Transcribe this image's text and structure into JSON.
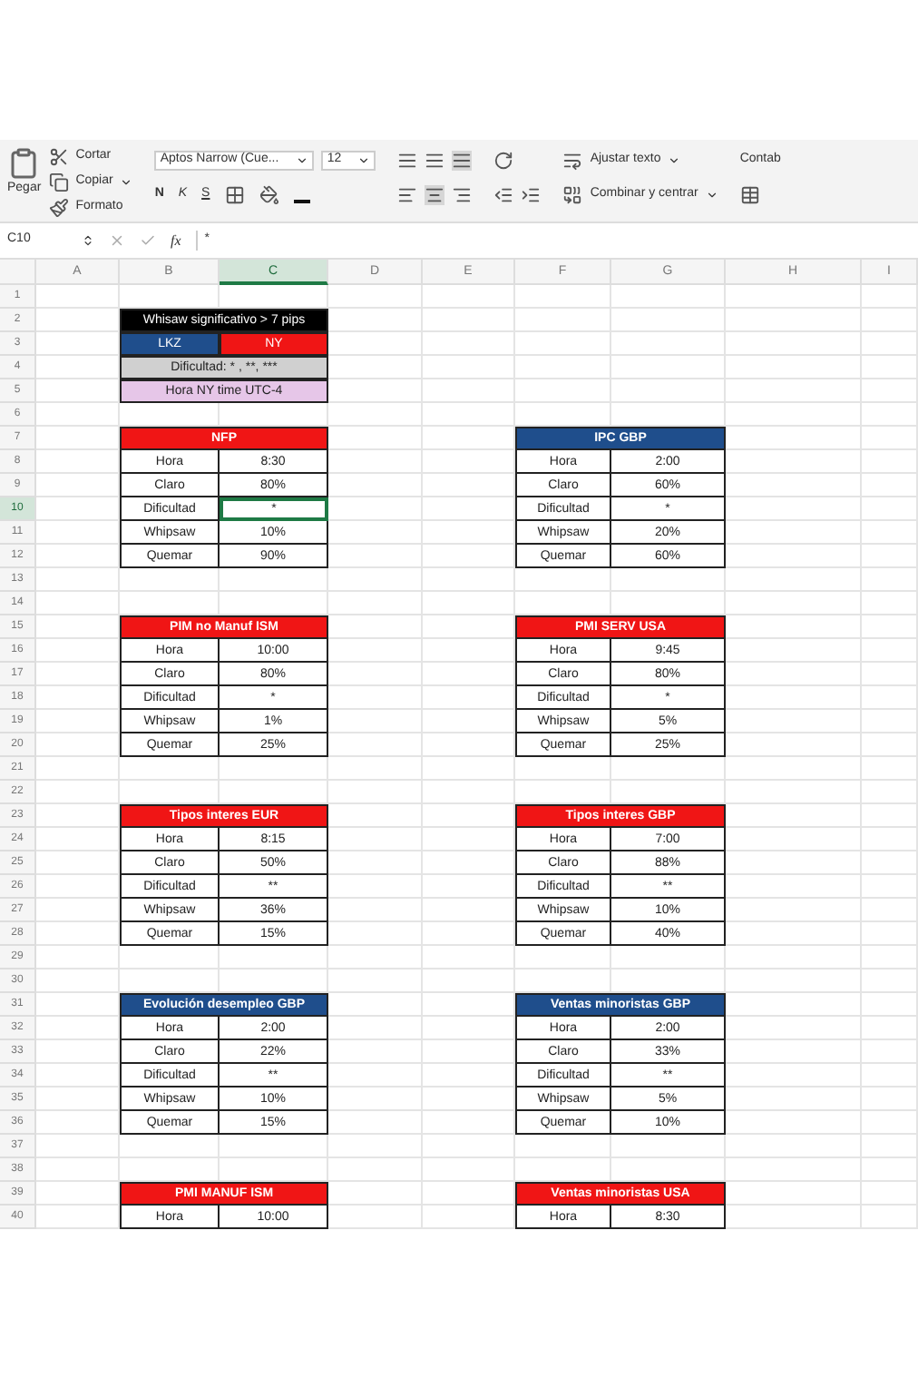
{
  "ribbon": {
    "clipboard": {
      "paste": "Pegar",
      "cut": "Cortar",
      "copy": "Copiar",
      "format": "Formato"
    },
    "font": {
      "name": "Aptos Narrow (Cue...",
      "size": "12",
      "styles": [
        "N",
        "K",
        "S"
      ]
    },
    "wrap_text": "Ajustar texto",
    "merge": "Combinar y centrar",
    "number_format": "Contab"
  },
  "formula_bar": {
    "name_box": "C10",
    "fx": "fx",
    "value": "*"
  },
  "columns": [
    {
      "label": "A",
      "selected": false
    },
    {
      "label": "B",
      "selected": false
    },
    {
      "label": "C",
      "selected": true
    },
    {
      "label": "D",
      "selected": false
    },
    {
      "label": "E",
      "selected": false
    },
    {
      "label": "F",
      "selected": false
    },
    {
      "label": "G",
      "selected": false
    },
    {
      "label": "H",
      "selected": false
    },
    {
      "label": "I",
      "selected": false
    }
  ],
  "row_numbers": [
    {
      "label": "1",
      "selected": false
    },
    {
      "label": "2",
      "selected": false
    },
    {
      "label": "3",
      "selected": false
    },
    {
      "label": "4",
      "selected": false
    },
    {
      "label": "5",
      "selected": false
    },
    {
      "label": "6",
      "selected": false
    },
    {
      "label": "7",
      "selected": false
    },
    {
      "label": "8",
      "selected": false
    },
    {
      "label": "9",
      "selected": false
    },
    {
      "label": "10",
      "selected": true
    },
    {
      "label": "11",
      "selected": false
    },
    {
      "label": "12",
      "selected": false
    },
    {
      "label": "13",
      "selected": false
    },
    {
      "label": "14",
      "selected": false
    },
    {
      "label": "15",
      "selected": false
    },
    {
      "label": "16",
      "selected": false
    },
    {
      "label": "17",
      "selected": false
    },
    {
      "label": "18",
      "selected": false
    },
    {
      "label": "19",
      "selected": false
    },
    {
      "label": "20",
      "selected": false
    },
    {
      "label": "21",
      "selected": false
    },
    {
      "label": "22",
      "selected": false
    },
    {
      "label": "23",
      "selected": false
    },
    {
      "label": "24",
      "selected": false
    },
    {
      "label": "25",
      "selected": false
    },
    {
      "label": "26",
      "selected": false
    },
    {
      "label": "27",
      "selected": false
    },
    {
      "label": "28",
      "selected": false
    },
    {
      "label": "29",
      "selected": false
    },
    {
      "label": "30",
      "selected": false
    },
    {
      "label": "31",
      "selected": false
    },
    {
      "label": "32",
      "selected": false
    },
    {
      "label": "33",
      "selected": false
    },
    {
      "label": "34",
      "selected": false
    },
    {
      "label": "35",
      "selected": false
    },
    {
      "label": "36",
      "selected": false
    },
    {
      "label": "37",
      "selected": false
    },
    {
      "label": "38",
      "selected": false
    },
    {
      "label": "39",
      "selected": false
    },
    {
      "label": "40",
      "selected": false
    }
  ],
  "legend": [
    {
      "kind": "title",
      "text": "Whisaw significativo > 7 pips"
    },
    {
      "kind": "split",
      "items": [
        {
          "text": "LKZ",
          "color": "#1f4e8c"
        },
        {
          "text": "NY",
          "color": "#f01515"
        }
      ]
    },
    {
      "kind": "note",
      "text": "Dificultad: * , **, ***",
      "color": "#d0d0d0"
    },
    {
      "kind": "note",
      "text": "Hora NY time UTC-4",
      "color": "#e6c6e8"
    }
  ],
  "tables": [
    {
      "title": "NFP",
      "color": "#f01515",
      "rows": [
        {
          "label": "Hora",
          "value": "8:30",
          "selected": false
        },
        {
          "label": "Claro",
          "value": "80%",
          "selected": false
        },
        {
          "label": "Dificultad",
          "value": "*",
          "selected": true
        },
        {
          "label": "Whipsaw",
          "value": "10%",
          "selected": false
        },
        {
          "label": "Quemar",
          "value": "90%",
          "selected": false
        }
      ]
    },
    {
      "title": "IPC GBP",
      "color": "#1f4e8c",
      "rows": [
        {
          "label": "Hora",
          "value": "2:00",
          "selected": false
        },
        {
          "label": "Claro",
          "value": "60%",
          "selected": false
        },
        {
          "label": "Dificultad",
          "value": "*",
          "selected": false
        },
        {
          "label": "Whipsaw",
          "value": "20%",
          "selected": false
        },
        {
          "label": "Quemar",
          "value": "60%",
          "selected": false
        }
      ]
    },
    {
      "title": "PIM no Manuf ISM",
      "color": "#f01515",
      "rows": [
        {
          "label": "Hora",
          "value": "10:00",
          "selected": false
        },
        {
          "label": "Claro",
          "value": "80%",
          "selected": false
        },
        {
          "label": "Dificultad",
          "value": "*",
          "selected": false
        },
        {
          "label": "Whipsaw",
          "value": "1%",
          "selected": false
        },
        {
          "label": "Quemar",
          "value": "25%",
          "selected": false
        }
      ]
    },
    {
      "title": "PMI SERV USA",
      "color": "#f01515",
      "rows": [
        {
          "label": "Hora",
          "value": "9:45",
          "selected": false
        },
        {
          "label": "Claro",
          "value": "80%",
          "selected": false
        },
        {
          "label": "Dificultad",
          "value": "*",
          "selected": false
        },
        {
          "label": "Whipsaw",
          "value": "5%",
          "selected": false
        },
        {
          "label": "Quemar",
          "value": "25%",
          "selected": false
        }
      ]
    },
    {
      "title": "Tipos interes EUR",
      "color": "#f01515",
      "rows": [
        {
          "label": "Hora",
          "value": "8:15",
          "selected": false
        },
        {
          "label": "Claro",
          "value": "50%",
          "selected": false
        },
        {
          "label": "Dificultad",
          "value": "**",
          "selected": false
        },
        {
          "label": "Whipsaw",
          "value": "36%",
          "selected": false
        },
        {
          "label": "Quemar",
          "value": "15%",
          "selected": false
        }
      ]
    },
    {
      "title": "Tipos interes GBP",
      "color": "#f01515",
      "rows": [
        {
          "label": "Hora",
          "value": "7:00",
          "selected": false
        },
        {
          "label": "Claro",
          "value": "88%",
          "selected": false
        },
        {
          "label": "Dificultad",
          "value": "**",
          "selected": false
        },
        {
          "label": "Whipsaw",
          "value": "10%",
          "selected": false
        },
        {
          "label": "Quemar",
          "value": "40%",
          "selected": false
        }
      ]
    },
    {
      "title": "Evolución desempleo GBP",
      "color": "#1f4e8c",
      "rows": [
        {
          "label": "Hora",
          "value": "2:00",
          "selected": false
        },
        {
          "label": "Claro",
          "value": "22%",
          "selected": false
        },
        {
          "label": "Dificultad",
          "value": "**",
          "selected": false
        },
        {
          "label": "Whipsaw",
          "value": "10%",
          "selected": false
        },
        {
          "label": "Quemar",
          "value": "15%",
          "selected": false
        }
      ]
    },
    {
      "title": "Ventas minoristas GBP",
      "color": "#1f4e8c",
      "rows": [
        {
          "label": "Hora",
          "value": "2:00",
          "selected": false
        },
        {
          "label": "Claro",
          "value": "33%",
          "selected": false
        },
        {
          "label": "Dificultad",
          "value": "**",
          "selected": false
        },
        {
          "label": "Whipsaw",
          "value": "5%",
          "selected": false
        },
        {
          "label": "Quemar",
          "value": "10%",
          "selected": false
        }
      ]
    },
    {
      "title": "PMI MANUF ISM",
      "color": "#f01515",
      "rows": [
        {
          "label": "Hora",
          "value": "10:00",
          "selected": false
        }
      ]
    },
    {
      "title": "Ventas minoristas USA",
      "color": "#f01515",
      "rows": [
        {
          "label": "Hora",
          "value": "8:30",
          "selected": false
        }
      ]
    }
  ]
}
